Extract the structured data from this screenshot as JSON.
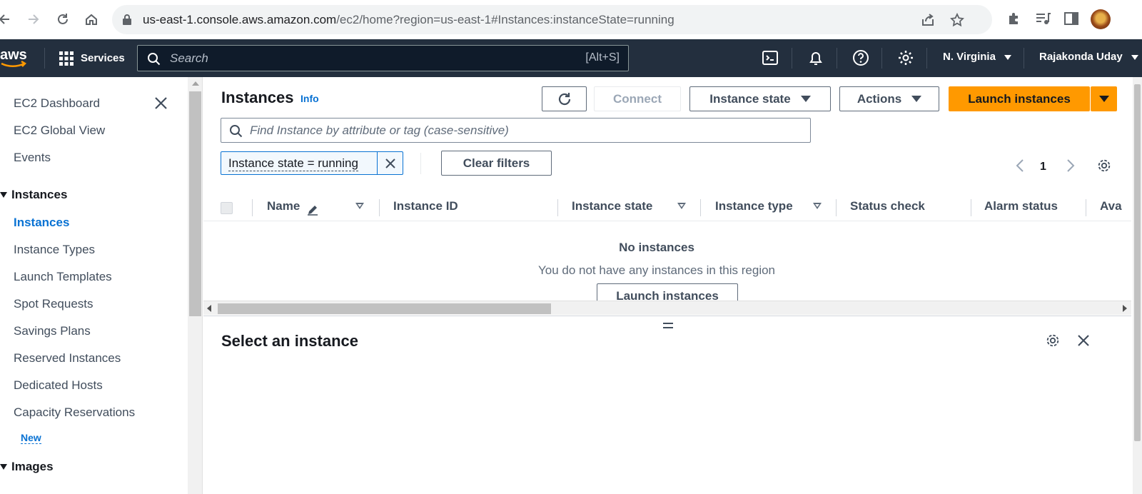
{
  "browser": {
    "url_host": "us-east-1.console.aws.amazon.com",
    "url_path": "/ec2/home?region=us-east-1#Instances:instanceState=running"
  },
  "topnav": {
    "logo": "aws",
    "services_label": "Services",
    "search_placeholder": "Search",
    "search_shortcut": "[Alt+S]",
    "region": "N. Virginia",
    "user": "Rajakonda Uday"
  },
  "sidebar": {
    "items_top": [
      "EC2 Dashboard",
      "EC2 Global View",
      "Events"
    ],
    "section_instances": "Instances",
    "instances_items": [
      "Instances",
      "Instance Types",
      "Launch Templates",
      "Spot Requests",
      "Savings Plans",
      "Reserved Instances",
      "Dedicated Hosts",
      "Capacity Reservations"
    ],
    "new_badge": "New",
    "section_images": "Images"
  },
  "main": {
    "title": "Instances",
    "info": "Info",
    "connect": "Connect",
    "instance_state": "Instance state",
    "actions": "Actions",
    "launch_instances": "Launch instances",
    "filter_placeholder": "Find Instance by attribute or tag (case-sensitive)",
    "filter_token": "Instance state = running",
    "clear_filters": "Clear filters",
    "page_number": "1",
    "columns": [
      "Name",
      "Instance ID",
      "Instance state",
      "Instance type",
      "Status check",
      "Alarm status",
      "Ava"
    ],
    "empty_title": "No instances",
    "empty_subtitle": "You do not have any instances in this region",
    "empty_button": "Launch instances",
    "details_title": "Select an instance"
  },
  "colors": {
    "aws_nav": "#232f3e",
    "primary_orange": "#ff9900",
    "link_blue": "#0972d3"
  }
}
